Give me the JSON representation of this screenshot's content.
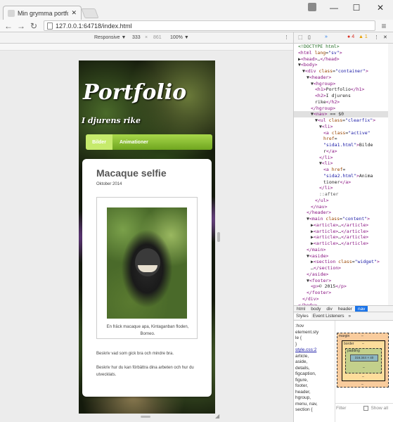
{
  "browser": {
    "tab_title": "Min grymma portfolio",
    "url": "127.0.0.1:64718/index.html"
  },
  "device_toolbar": {
    "mode": "Responsive ▼",
    "width": "333",
    "times": "×",
    "height": "861",
    "zoom": "100% ▼"
  },
  "page": {
    "logo": "Portfolio",
    "subtitle": "I djurens rike",
    "nav": [
      "Bilder",
      "Animationer"
    ],
    "article": {
      "title": "Macaque selfie",
      "date": "Oktober 2014",
      "caption": "En fräck macaque apa, Kintaganban floden, Borneo.",
      "p1": "Beskriv vad som gick bra och mindre bra.",
      "p2": "Beskriv hur du kan förbättra dina arbeten och hur du utvecklats."
    }
  },
  "devtools": {
    "errors": "4",
    "warnings": "1",
    "tree": [
      {
        "i": 1,
        "h": "<span class='cmt'>&lt;!DOCTYPE html&gt;</span>"
      },
      {
        "i": 1,
        "h": "<span class='tag'>&lt;html</span> <span class='attr'>lang</span>=<span class='val'>\"sv\"</span><span class='tag'>&gt;</span>"
      },
      {
        "i": 1,
        "h": "▶<span class='tag'>&lt;head&gt;</span>…<span class='tag'>&lt;/head&gt;</span>"
      },
      {
        "i": 1,
        "h": "▼<span class='tag'>&lt;body&gt;</span>"
      },
      {
        "i": 2,
        "h": "▼<span class='tag'>&lt;div</span> <span class='attr'>class</span>=<span class='val'>\"container\"</span><span class='tag'>&gt;</span>"
      },
      {
        "i": 3,
        "h": "▼<span class='tag'>&lt;header&gt;</span>"
      },
      {
        "i": 4,
        "h": "▼<span class='tag'>&lt;hgroup&gt;</span>"
      },
      {
        "i": 5,
        "h": "<span class='tag'>&lt;h1&gt;</span><span class='txt'>Portfolio</span><span class='tag'>&lt;/h1&gt;</span>"
      },
      {
        "i": 5,
        "h": "<span class='tag'>&lt;h2&gt;</span><span class='txt'>I djurens</span>"
      },
      {
        "i": 5,
        "h": "<span class='txt'>rike</span><span class='tag'>&lt;/h2&gt;</span>"
      },
      {
        "i": 4,
        "h": "<span class='tag'>&lt;/hgroup&gt;</span>"
      },
      {
        "i": 4,
        "h": "▼<span class='tag'>&lt;nav&gt;</span> == $0",
        "sel": true
      },
      {
        "i": 5,
        "h": "▼<span class='tag'>&lt;ul</span> <span class='attr'>class</span>=<span class='val'>\"clearfix\"</span><span class='tag'>&gt;</span>"
      },
      {
        "i": 6,
        "h": "▼<span class='tag'>&lt;li&gt;</span>"
      },
      {
        "i": 7,
        "h": "<span class='tag'>&lt;a</span> <span class='attr'>class</span>=<span class='val'>\"active\"</span>"
      },
      {
        "i": 7,
        "h": "<span class='attr'>href</span>="
      },
      {
        "i": 7,
        "h": "<span class='val'>\"sida1.html\"</span><span class='tag'>&gt;</span><span class='txt'>Bilde</span>"
      },
      {
        "i": 7,
        "h": "<span class='txt'>r</span><span class='tag'>&lt;/a&gt;</span>"
      },
      {
        "i": 6,
        "h": "<span class='tag'>&lt;/li&gt;</span>"
      },
      {
        "i": 6,
        "h": "▼<span class='tag'>&lt;li&gt;</span>"
      },
      {
        "i": 7,
        "h": "<span class='tag'>&lt;a</span> <span class='attr'>href</span>="
      },
      {
        "i": 7,
        "h": "<span class='val'>\"sida2.html\"</span><span class='tag'>&gt;</span><span class='txt'>Anima</span>"
      },
      {
        "i": 7,
        "h": "<span class='txt'>tioner</span><span class='tag'>&lt;/a&gt;</span>"
      },
      {
        "i": 6,
        "h": "<span class='tag'>&lt;/li&gt;</span>"
      },
      {
        "i": 6,
        "h": "<span class='pseudo'>::after</span>"
      },
      {
        "i": 5,
        "h": "<span class='tag'>&lt;/ul&gt;</span>"
      },
      {
        "i": 4,
        "h": "<span class='tag'>&lt;/nav&gt;</span>"
      },
      {
        "i": 3,
        "h": "<span class='tag'>&lt;/header&gt;</span>"
      },
      {
        "i": 3,
        "h": "▼<span class='tag'>&lt;main</span> <span class='attr'>class</span>=<span class='val'>\"content\"</span><span class='tag'>&gt;</span>"
      },
      {
        "i": 4,
        "h": "▶<span class='tag'>&lt;article&gt;</span>…<span class='tag'>&lt;/article&gt;</span>"
      },
      {
        "i": 4,
        "h": "▶<span class='tag'>&lt;article&gt;</span>…<span class='tag'>&lt;/article&gt;</span>"
      },
      {
        "i": 4,
        "h": "▶<span class='tag'>&lt;article&gt;</span>…<span class='tag'>&lt;/article&gt;</span>"
      },
      {
        "i": 4,
        "h": "▶<span class='tag'>&lt;article&gt;</span>…<span class='tag'>&lt;/article&gt;</span>"
      },
      {
        "i": 3,
        "h": "<span class='tag'>&lt;/main&gt;</span>"
      },
      {
        "i": 3,
        "h": "▼<span class='tag'>&lt;aside&gt;</span>"
      },
      {
        "i": 4,
        "h": "▶<span class='tag'>&lt;section</span> <span class='attr'>class</span>=<span class='val'>\"widget\"</span><span class='tag'>&gt;</span>"
      },
      {
        "i": 4,
        "h": "…<span class='tag'>&lt;/section&gt;</span>"
      },
      {
        "i": 3,
        "h": "<span class='tag'>&lt;/aside&gt;</span>"
      },
      {
        "i": 3,
        "h": "▼<span class='tag'>&lt;footer&gt;</span>"
      },
      {
        "i": 4,
        "h": "<span class='tag'>&lt;p&gt;</span><span class='txt'>© 2015</span><span class='tag'>&lt;/p&gt;</span>"
      },
      {
        "i": 3,
        "h": "<span class='tag'>&lt;/footer&gt;</span>"
      },
      {
        "i": 2,
        "h": "<span class='tag'>&lt;/div&gt;</span>"
      },
      {
        "i": 1,
        "h": "<span class='tag'>&lt;/body&gt;</span>"
      }
    ],
    "breadcrumbs": [
      "html",
      "body",
      "div",
      "header",
      "nav"
    ],
    "subtabs": [
      "Styles",
      "Event Listeners",
      "»"
    ],
    "styles_lines": [
      ":hov",
      "element.sty",
      "le {",
      "}",
      "style.css:2",
      "article,",
      "aside,",
      "details,",
      "figcaption,",
      "figure,",
      "footer,",
      "header,",
      "hgroup,",
      "menu, nav,",
      "section {"
    ],
    "box": {
      "margin_label": "margin",
      "border_label": "border",
      "padding_label": "padding",
      "content": "316.344 × 40",
      "dash": "–"
    },
    "filter": "Filter",
    "show_all": "Show all"
  }
}
